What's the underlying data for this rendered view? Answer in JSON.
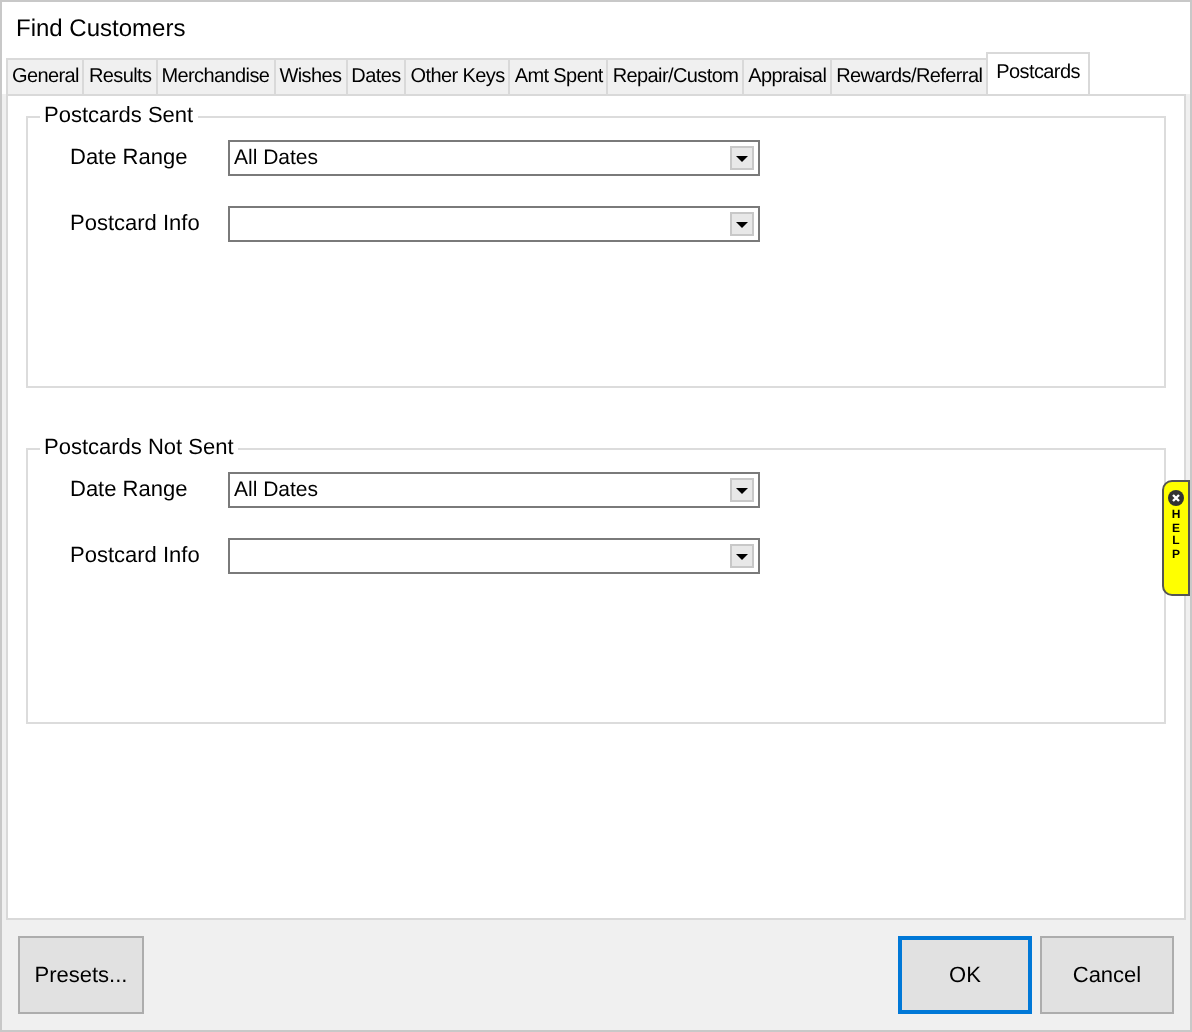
{
  "window": {
    "title": "Find Customers"
  },
  "tabs": [
    {
      "label": "General",
      "selected": false
    },
    {
      "label": "Results",
      "selected": false
    },
    {
      "label": "Merchandise",
      "selected": false
    },
    {
      "label": "Wishes",
      "selected": false
    },
    {
      "label": "Dates",
      "selected": false
    },
    {
      "label": "Other Keys",
      "selected": false
    },
    {
      "label": "Amt Spent",
      "selected": false
    },
    {
      "label": "Repair/Custom",
      "selected": false
    },
    {
      "label": "Appraisal",
      "selected": false
    },
    {
      "label": "Rewards/Referral",
      "selected": false
    },
    {
      "label": "Postcards",
      "selected": true
    }
  ],
  "groups": [
    {
      "title": "Postcards Sent",
      "fields": [
        {
          "label": "Date Range",
          "value": "All Dates"
        },
        {
          "label": "Postcard Info"
        }
      ]
    },
    {
      "title": "Postcards Not Sent",
      "fields": [
        {
          "label": "Date Range",
          "value": "All Dates"
        },
        {
          "label": "Postcard Info"
        }
      ]
    }
  ],
  "help_tab": {
    "label": "HELP"
  },
  "buttons": [
    {
      "label": "Presets...",
      "focused": false
    },
    {
      "label": "OK",
      "focused": true
    },
    {
      "label": "Cancel",
      "focused": false
    }
  ]
}
